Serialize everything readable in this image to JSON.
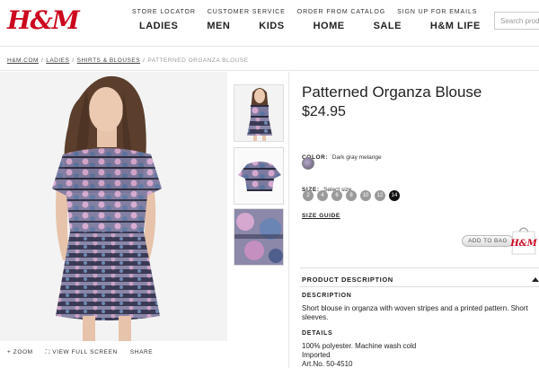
{
  "header": {
    "logo": "H&M",
    "utility_links": [
      "STORE LOCATOR",
      "CUSTOMER SERVICE",
      "ORDER FROM CATALOG",
      "SIGN UP FOR EMAILS"
    ],
    "nav": [
      "LADIES",
      "MEN",
      "KIDS",
      "HOME",
      "SALE",
      "H&M LIFE"
    ],
    "search_placeholder": "Search products"
  },
  "breadcrumb": {
    "items": [
      "H&M.COM",
      "LADIES",
      "SHIRTS & BLOUSES"
    ],
    "current": "PATTERNED ORGANZA BLOUSE"
  },
  "image_tools": {
    "zoom": "+ ZOOM",
    "full_screen": "VIEW FULL SCREEN",
    "share": "SHARE"
  },
  "product": {
    "title": "Patterned Organza Blouse",
    "price": "$24.95",
    "color_label": "COLOR:",
    "color_value": "Dark gray melange",
    "size_label": "SIZE:",
    "size_prompt": "Select size",
    "sizes": [
      "2",
      "4",
      "6",
      "8",
      "10",
      "12",
      "14"
    ],
    "selected_size": "14",
    "size_guide": "SIZE GUIDE",
    "add_to_bag": "ADD TO BAG",
    "bag_logo": "H&M"
  },
  "info": {
    "section_title": "PRODUCT DESCRIPTION",
    "description_heading": "DESCRIPTION",
    "description_text": "Short blouse in organza with woven stripes and a printed pattern. Short sleeves.",
    "details_heading": "DETAILS",
    "details": [
      "100% polyester. Machine wash cold",
      "Imported",
      "Art.No. 50-4510"
    ]
  }
}
